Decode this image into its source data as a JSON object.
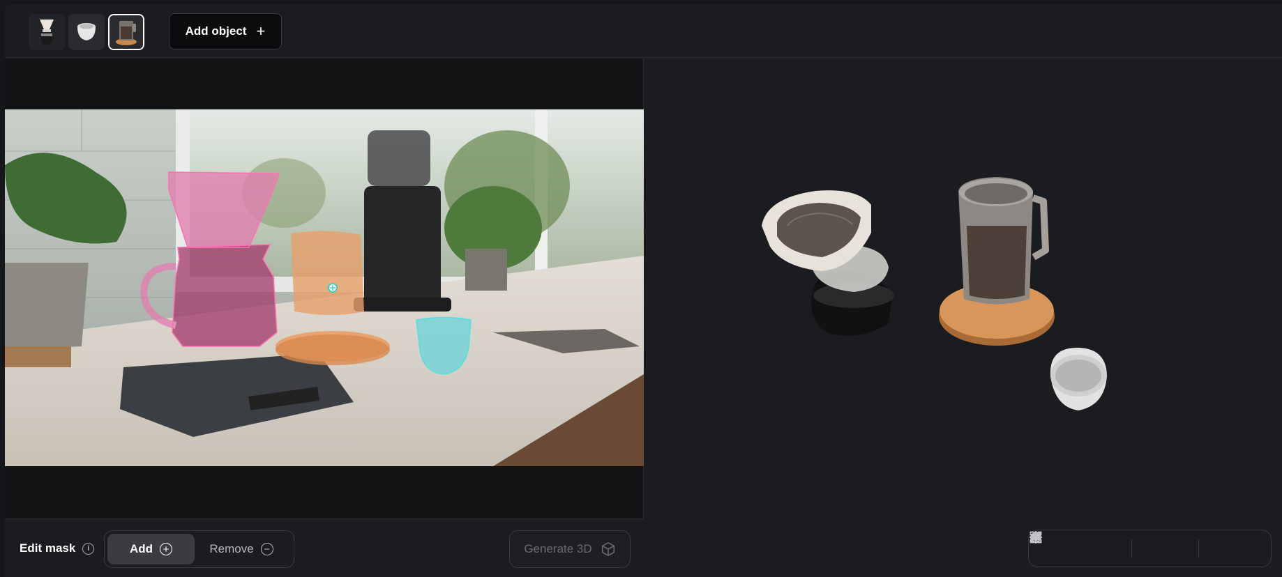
{
  "topbar": {
    "thumbnails": [
      {
        "name": "pour-over-dripper",
        "active": false
      },
      {
        "name": "white-cup",
        "active": false
      },
      {
        "name": "glass-mug-coaster",
        "active": true
      }
    ],
    "add_object_label": "Add object",
    "add_object_icon": "plus-icon"
  },
  "editor": {
    "edit_mask_label": "Edit mask",
    "info_icon": "info-icon",
    "add_label": "Add",
    "remove_label": "Remove",
    "generate_label": "Generate 3D",
    "generate_icon": "cube-icon",
    "mask_colors": {
      "dripper": "#e27fb0",
      "mug": "#e8a06a",
      "cup": "#6fd3d8"
    },
    "point_marker_color": "#3fcfc4"
  },
  "viewport": {
    "tools": [
      "move-icon",
      "rotate-object-icon",
      "scale-icon",
      "reset-icon",
      "delete-icon",
      "zoom-fit-icon",
      "frame-icon"
    ]
  },
  "colors": {
    "background": "#1b1c1f",
    "panel": "#121315",
    "border": "#3a3b40"
  }
}
